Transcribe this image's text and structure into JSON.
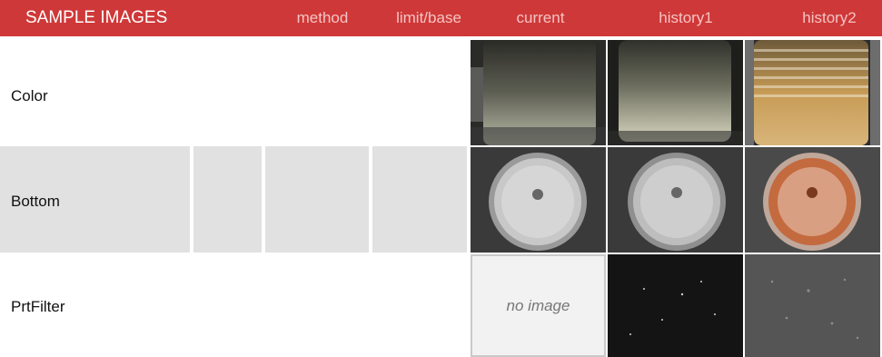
{
  "header": {
    "title": "SAMPLE IMAGES",
    "columns": [
      "method",
      "limit/base",
      "current",
      "history1",
      "history2"
    ]
  },
  "rows": [
    {
      "label": "Color"
    },
    {
      "label": "Bottom"
    },
    {
      "label": "PrtFilter"
    }
  ],
  "placeholder": "no image"
}
